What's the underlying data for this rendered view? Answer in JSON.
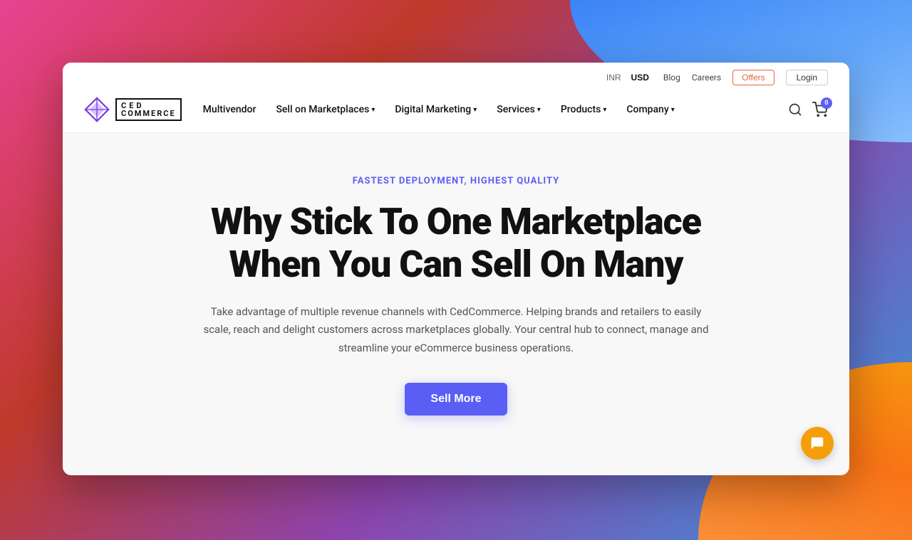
{
  "outer": {
    "description": "Decorative gradient background"
  },
  "header": {
    "currency": {
      "options": [
        "INR",
        "USD"
      ],
      "active": "USD"
    },
    "top_links": [
      "Blog",
      "Careers"
    ],
    "offers_label": "Offers",
    "login_label": "Login",
    "logo": {
      "text_top": "CED",
      "text_bottom": "COMMERCE"
    },
    "nav_items": [
      {
        "label": "Multivendor",
        "has_dropdown": false
      },
      {
        "label": "Sell on Marketplaces",
        "has_dropdown": true
      },
      {
        "label": "Digital Marketing",
        "has_dropdown": true
      },
      {
        "label": "Services",
        "has_dropdown": true
      },
      {
        "label": "Products",
        "has_dropdown": true
      },
      {
        "label": "Company",
        "has_dropdown": true
      }
    ],
    "cart_count": "0"
  },
  "hero": {
    "tag": "FASTEST DEPLOYMENT, HIGHEST QUALITY",
    "title_line1": "Why Stick To One Marketplace",
    "title_line2": "When You Can Sell On Many",
    "description": "Take advantage of multiple revenue channels with CedCommerce. Helping brands and retailers to easily scale, reach and delight customers across marketplaces globally.  Your central hub to connect, manage and streamline your eCommerce business operations.",
    "cta_label": "Sell More"
  }
}
